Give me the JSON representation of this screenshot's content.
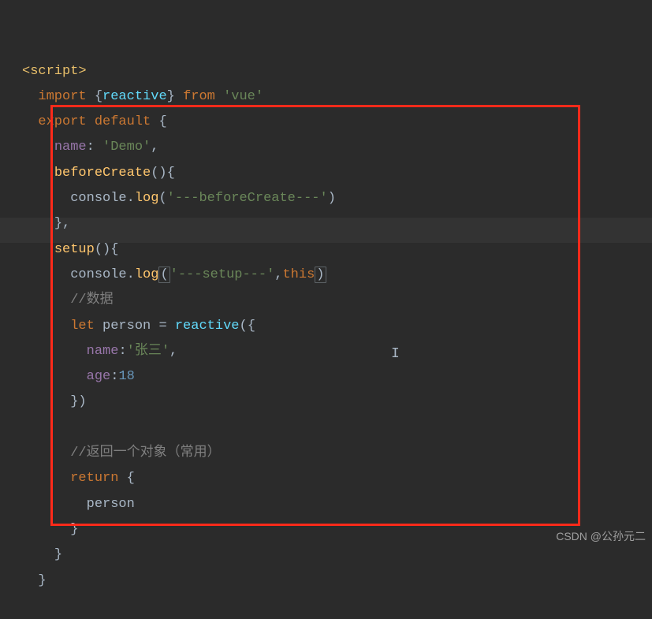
{
  "code": {
    "script_open": "<script>",
    "kw_import": "import",
    "brace_open": "{",
    "reactive": "reactive",
    "brace_close": "}",
    "kw_from": "from",
    "str_vue": "'vue'",
    "kw_export": "export",
    "kw_default": "default",
    "prop_name": "name",
    "colon": ":",
    "str_demo": "'Demo'",
    "comma": ",",
    "fn_beforeCreate": "beforeCreate",
    "parens": "()",
    "console": "console",
    "dot": ".",
    "log": "log",
    "paren_open": "(",
    "str_beforeCreate": "'---beforeCreate---'",
    "paren_close": ")",
    "fn_setup": "setup",
    "str_setup": "'---setup---'",
    "kw_this": "this",
    "comment_data": "//数据",
    "kw_let": "let",
    "var_person": "person",
    "equals": "=",
    "str_zhangsan": "'张三'",
    "prop_age": "age",
    "num_18": "18",
    "close_obj_paren": "})",
    "comment_return": "//返回一个对象（常用）",
    "kw_return": "return",
    "person_ref": "person"
  },
  "watermark": "CSDN @公孙元二"
}
